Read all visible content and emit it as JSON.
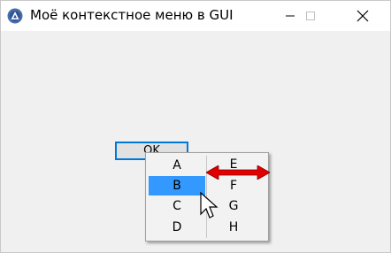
{
  "window": {
    "title": "Моё контекстное меню в GUI"
  },
  "titlebar": {
    "app_icon": "autoit-app-icon",
    "minimize_icon": "minimize-icon",
    "maximize_icon": "maximize-icon",
    "close_icon": "close-icon"
  },
  "ok_button": {
    "label": "OK"
  },
  "context_menu": {
    "left_column": [
      "A",
      "B",
      "C",
      "D"
    ],
    "right_column": [
      "E",
      "F",
      "G",
      "H"
    ],
    "selected": "B"
  },
  "annotations": {
    "arrow": "double-headed-red-arrow",
    "pointer": "mouse-cursor-icon"
  },
  "colors": {
    "selection": "#3399ff",
    "focus_border": "#0078d7",
    "arrow": "#e00000"
  }
}
